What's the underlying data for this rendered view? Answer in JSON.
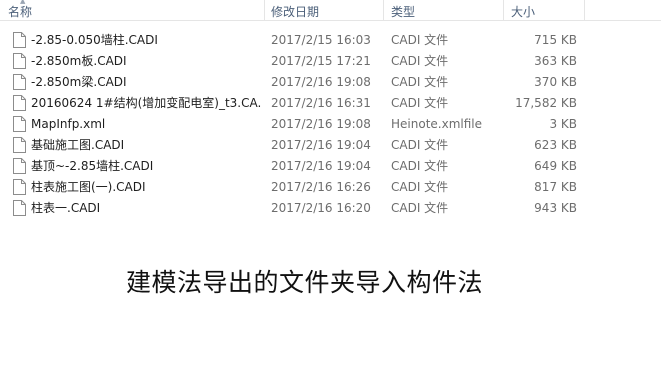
{
  "columns": {
    "name": "名称",
    "date": "修改日期",
    "type": "类型",
    "size": "大小"
  },
  "files": [
    {
      "name": "-2.85-0.050墙柱.CADI",
      "date": "2017/2/15 16:03",
      "type": "CADI 文件",
      "size": "715 KB",
      "icon": "file-icon"
    },
    {
      "name": "-2.850m板.CADI",
      "date": "2017/2/15 17:21",
      "type": "CADI 文件",
      "size": "363 KB",
      "icon": "file-icon"
    },
    {
      "name": "-2.850m梁.CADI",
      "date": "2017/2/16 19:08",
      "type": "CADI 文件",
      "size": "370 KB",
      "icon": "file-icon"
    },
    {
      "name": "20160624 1#结构(增加变配电室)_t3.CA...",
      "date": "2017/2/16 16:31",
      "type": "CADI 文件",
      "size": "17,582 KB",
      "icon": "file-icon"
    },
    {
      "name": "MapInfp.xml",
      "date": "2017/2/16 19:08",
      "type": "Heinote.xmlfile",
      "size": "3 KB",
      "icon": "file-icon"
    },
    {
      "name": "基础施工图.CADI",
      "date": "2017/2/16 19:04",
      "type": "CADI 文件",
      "size": "623 KB",
      "icon": "file-icon"
    },
    {
      "name": "基顶~-2.85墙柱.CADI",
      "date": "2017/2/16 19:04",
      "type": "CADI 文件",
      "size": "649 KB",
      "icon": "file-icon"
    },
    {
      "name": "柱表施工图(一).CADI",
      "date": "2017/2/16 16:26",
      "type": "CADI 文件",
      "size": "817 KB",
      "icon": "file-icon"
    },
    {
      "name": "柱表一.CADI",
      "date": "2017/2/16 16:20",
      "type": "CADI 文件",
      "size": "943 KB",
      "icon": "file-icon"
    }
  ],
  "caption": "建模法导出的文件夹导入构件法"
}
